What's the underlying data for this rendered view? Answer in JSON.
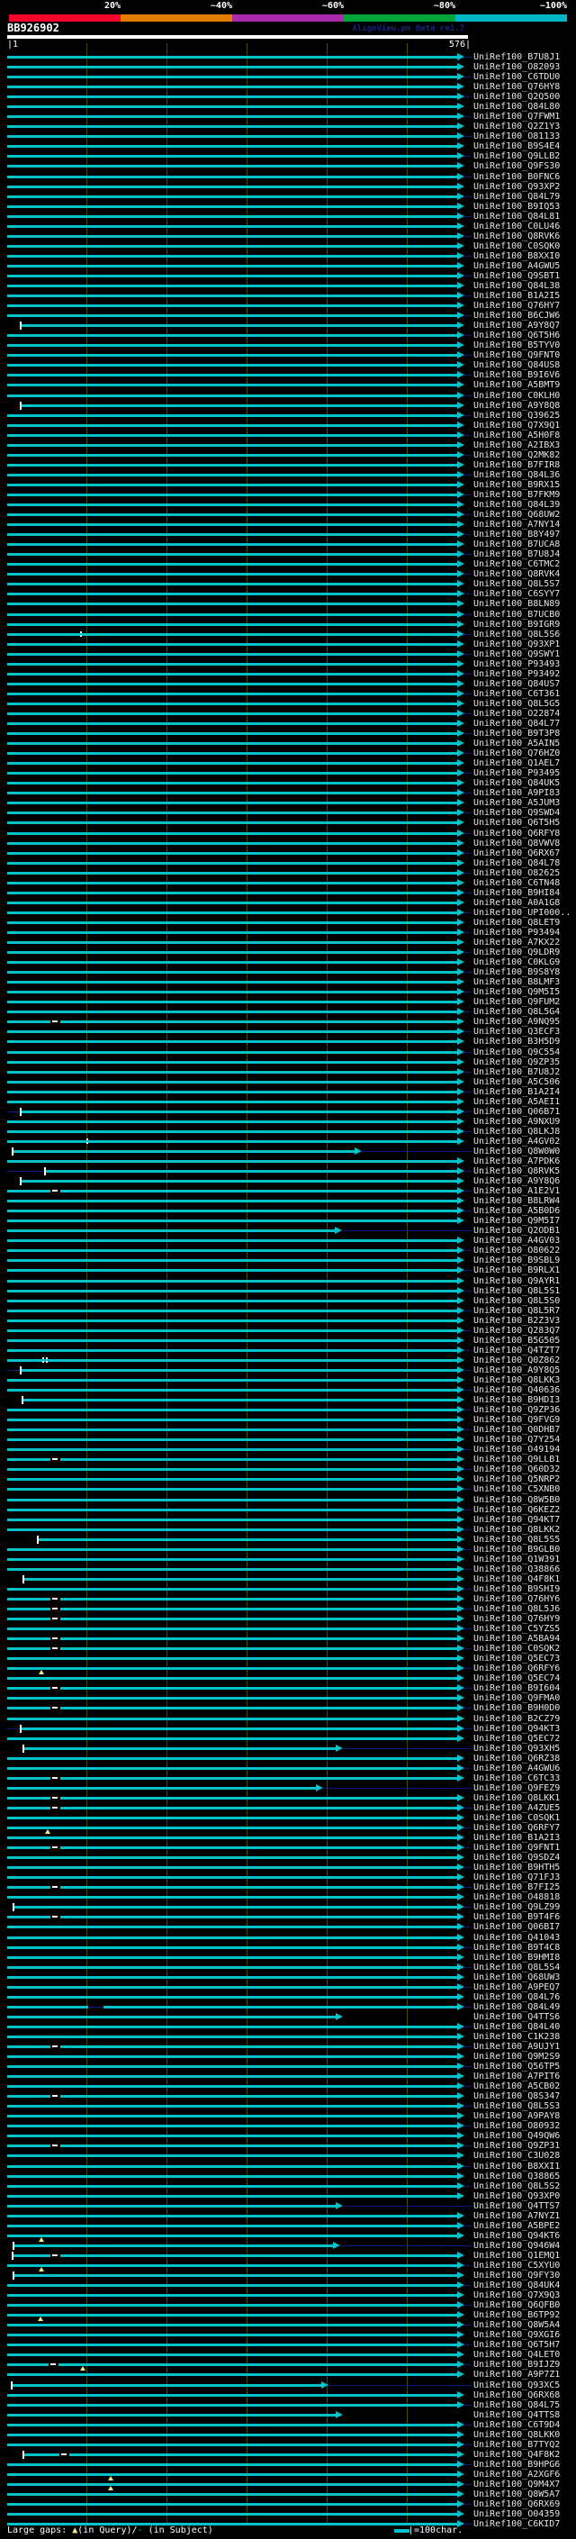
{
  "header": {
    "scale": {
      "segments": [
        {
          "label": "20%",
          "color": "#f2062c"
        },
        {
          "label": "~40%",
          "color": "#e57d00"
        },
        {
          "label": "~60%",
          "color": "#a92aaa"
        },
        {
          "label": "~80%",
          "color": "#00a63c"
        },
        {
          "label": "~100%",
          "color": "#00b7c3"
        }
      ]
    },
    "query_name": "BB926902",
    "watermark": "AlignView.pm Beta re1.7",
    "ruler": {
      "start_label": "|1",
      "end_label": "576|"
    }
  },
  "chart_data": {
    "type": "alignment-coverage-map",
    "title": "BB926902",
    "query_length": 576,
    "tick_interval_chars": 100,
    "label_prefix": "UniRef100_",
    "colors": {
      "bar": "#00c2cb",
      "tail": "#0a1a80",
      "grid": "#454500",
      "gap_query_triangle": "#f0f07c",
      "gap_subject_dash": "#ffffff",
      "label_text": "#e5e5e5"
    },
    "rows": [
      {
        "acc": "B7U8J1"
      },
      {
        "acc": "O82093"
      },
      {
        "acc": "C6TDU0"
      },
      {
        "acc": "Q76HY8"
      },
      {
        "acc": "Q2Q500"
      },
      {
        "acc": "Q84L80"
      },
      {
        "acc": "Q7FWM1"
      },
      {
        "acc": "Q2Z1Y3"
      },
      {
        "acc": "O81133"
      },
      {
        "acc": "B9S4E4"
      },
      {
        "acc": "Q9LLB2"
      },
      {
        "acc": "Q9FS30"
      },
      {
        "acc": "B0FNC6"
      },
      {
        "acc": "Q93XP2"
      },
      {
        "acc": "Q84L79"
      },
      {
        "acc": "B9IQ53"
      },
      {
        "acc": "Q84L81"
      },
      {
        "acc": "C0LU46"
      },
      {
        "acc": "Q8RVK6"
      },
      {
        "acc": "C0SQK0"
      },
      {
        "acc": "B8XXI0"
      },
      {
        "acc": "A4GWU5"
      },
      {
        "acc": "Q9SBT1"
      },
      {
        "acc": "Q84L38"
      },
      {
        "acc": "B1A2I5"
      },
      {
        "acc": "Q76HY7"
      },
      {
        "acc": "B6CJW6"
      },
      {
        "acc": "A9Y8Q7",
        "s": 18,
        "cap": true
      },
      {
        "acc": "Q6T5H6"
      },
      {
        "acc": "B5TYV0"
      },
      {
        "acc": "Q9FNT0"
      },
      {
        "acc": "Q84US8"
      },
      {
        "acc": "B9I6V6"
      },
      {
        "acc": "A5BMT9"
      },
      {
        "acc": "C0KLH0"
      },
      {
        "acc": "A9Y8Q8",
        "s": 18,
        "cap": true
      },
      {
        "acc": "Q39625"
      },
      {
        "acc": "Q7X9Q1"
      },
      {
        "acc": "A5H0F8"
      },
      {
        "acc": "A2IBX3"
      },
      {
        "acc": "Q2MK82"
      },
      {
        "acc": "B7FIR8"
      },
      {
        "acc": "Q84L36"
      },
      {
        "acc": "B9RX15"
      },
      {
        "acc": "B7FKM9"
      },
      {
        "acc": "Q84L39"
      },
      {
        "acc": "Q68UW2"
      },
      {
        "acc": "A7NY14"
      },
      {
        "acc": "B8Y497"
      },
      {
        "acc": "B7UCA8"
      },
      {
        "acc": "B7U8J4"
      },
      {
        "acc": "C6TMC2"
      },
      {
        "acc": "Q8RVK4"
      },
      {
        "acc": "Q8L5S7"
      },
      {
        "acc": "C6SYY7"
      },
      {
        "acc": "B8LN89"
      },
      {
        "acc": "B7UCB0"
      },
      {
        "acc": "B9IGR9"
      },
      {
        "acc": "Q8L5S6",
        "marks": [
          [
            "colon",
            92
          ]
        ]
      },
      {
        "acc": "Q93XP1"
      },
      {
        "acc": "Q9SWY1"
      },
      {
        "acc": "P93493"
      },
      {
        "acc": "P93492"
      },
      {
        "acc": "Q84US7"
      },
      {
        "acc": "C6T361"
      },
      {
        "acc": "Q8L5G5"
      },
      {
        "acc": "O22874"
      },
      {
        "acc": "Q84L77"
      },
      {
        "acc": "B9T3P8"
      },
      {
        "acc": "A5AIN5"
      },
      {
        "acc": "Q76HZ0"
      },
      {
        "acc": "Q1AEL7"
      },
      {
        "acc": "P93495"
      },
      {
        "acc": "Q84UK5"
      },
      {
        "acc": "A9PI83"
      },
      {
        "acc": "A5JUM3"
      },
      {
        "acc": "Q9SWD4"
      },
      {
        "acc": "Q6T5H5"
      },
      {
        "acc": "Q6RFY8"
      },
      {
        "acc": "Q8VWV8"
      },
      {
        "acc": "Q6RX67"
      },
      {
        "acc": "Q84L78"
      },
      {
        "acc": "O82625"
      },
      {
        "acc": "C6TN48"
      },
      {
        "acc": "B9HI84"
      },
      {
        "acc": "A0A1G8"
      },
      {
        "acc": "UPI000.."
      },
      {
        "acc": "Q8LET9"
      },
      {
        "acc": "P93494"
      },
      {
        "acc": "A7KX22"
      },
      {
        "acc": "Q9LDR9"
      },
      {
        "acc": "C0KLG9"
      },
      {
        "acc": "B9S8Y8"
      },
      {
        "acc": "B8LMF3"
      },
      {
        "acc": "Q9M5I5"
      },
      {
        "acc": "Q9FUM2"
      },
      {
        "acc": "Q8L5G4"
      },
      {
        "acc": "A9NQ95",
        "marks": [
          [
            "dash",
            61
          ]
        ]
      },
      {
        "acc": "Q3ECF3"
      },
      {
        "acc": "B3H5D9"
      },
      {
        "acc": "Q9C554"
      },
      {
        "acc": "Q9ZP35"
      },
      {
        "acc": "B7U8J2"
      },
      {
        "acc": "A5C506"
      },
      {
        "acc": "B1A2I4"
      },
      {
        "acc": "A5AEI1"
      },
      {
        "acc": "Q06B71",
        "s": 18,
        "cap": true,
        "lead": true
      },
      {
        "acc": "A9NXU9"
      },
      {
        "acc": "Q8LKJ8"
      },
      {
        "acc": "A4GV02",
        "marks": [
          [
            "colon",
            100
          ]
        ]
      },
      {
        "acc": "Q8W0W0",
        "s": 8,
        "cap": true,
        "e": 435
      },
      {
        "acc": "A7PDK6"
      },
      {
        "acc": "Q8RVK5",
        "s": 48,
        "cap": true,
        "lead": true
      },
      {
        "acc": "A9Y8Q6",
        "s": 18,
        "cap": true
      },
      {
        "acc": "A1E2V1",
        "marks": [
          [
            "dash",
            61
          ]
        ]
      },
      {
        "acc": "B8LRW4"
      },
      {
        "acc": "A5B0D6"
      },
      {
        "acc": "Q9M5I7"
      },
      {
        "acc": "Q2ODB1",
        "e": 410
      },
      {
        "acc": "A4GV03"
      },
      {
        "acc": "O80622"
      },
      {
        "acc": "B9SBL9"
      },
      {
        "acc": "B9RLX1"
      },
      {
        "acc": "Q9AYR1"
      },
      {
        "acc": "Q8L5S1"
      },
      {
        "acc": "Q8L5S0"
      },
      {
        "acc": "Q8L5R7"
      },
      {
        "acc": "B2Z3V3"
      },
      {
        "acc": "Q283Q7"
      },
      {
        "acc": "B5G505"
      },
      {
        "acc": "Q4TZT7"
      },
      {
        "acc": "Q0Z862",
        "marks": [
          [
            "colon2",
            45
          ]
        ]
      },
      {
        "acc": "A9Y8Q5",
        "s": 18,
        "cap": true,
        "lead": true
      },
      {
        "acc": "Q8LKK3"
      },
      {
        "acc": "Q40636"
      },
      {
        "acc": "B9HDI3",
        "s": 20,
        "cap": true
      },
      {
        "acc": "Q9ZP36"
      },
      {
        "acc": "Q9FVG9"
      },
      {
        "acc": "Q0DHB7"
      },
      {
        "acc": "Q7Y254"
      },
      {
        "acc": "O49194"
      },
      {
        "acc": "Q9LLB1",
        "marks": [
          [
            "dash",
            61
          ]
        ]
      },
      {
        "acc": "Q60D32"
      },
      {
        "acc": "Q5NRP2"
      },
      {
        "acc": "C5XNB0"
      },
      {
        "acc": "Q8W5B0"
      },
      {
        "acc": "Q6KEZ2"
      },
      {
        "acc": "Q94KT7"
      },
      {
        "acc": "Q8LKK2"
      },
      {
        "acc": "Q8L5S5",
        "s": 39,
        "cap": true
      },
      {
        "acc": "B9GLB0"
      },
      {
        "acc": "Q1W391"
      },
      {
        "acc": "Q38866"
      },
      {
        "acc": "Q4F8K1",
        "s": 21,
        "cap": true
      },
      {
        "acc": "B9SHI9"
      },
      {
        "acc": "Q76HY6",
        "marks": [
          [
            "dash",
            61
          ]
        ]
      },
      {
        "acc": "Q8L5J6",
        "marks": [
          [
            "dash",
            61
          ]
        ]
      },
      {
        "acc": "Q76HY9",
        "marks": [
          [
            "dash",
            61
          ]
        ]
      },
      {
        "acc": "C5YZS5"
      },
      {
        "acc": "A5BA94",
        "marks": [
          [
            "dash",
            61
          ]
        ]
      },
      {
        "acc": "C0SQK2",
        "marks": [
          [
            "dash",
            61
          ]
        ]
      },
      {
        "acc": "Q5EC73"
      },
      {
        "acc": "Q6RFY6",
        "marks": [
          [
            "tri",
            44
          ]
        ]
      },
      {
        "acc": "Q5EC74"
      },
      {
        "acc": "B9I604",
        "marks": [
          [
            "dash",
            61
          ]
        ]
      },
      {
        "acc": "Q9FMA0"
      },
      {
        "acc": "B9H0D0",
        "marks": [
          [
            "dash",
            61
          ]
        ]
      },
      {
        "acc": "B2CZ79"
      },
      {
        "acc": "Q94KT3",
        "s": 18,
        "cap": true,
        "lead": true
      },
      {
        "acc": "Q5EC72"
      },
      {
        "acc": "Q93XH5",
        "s": 21,
        "cap": true,
        "e": 411
      },
      {
        "acc": "Q6RZ38"
      },
      {
        "acc": "A4GWU6"
      },
      {
        "acc": "C6TC33",
        "marks": [
          [
            "dash",
            61
          ]
        ]
      },
      {
        "acc": "Q9FEZ9",
        "e": 386
      },
      {
        "acc": "Q8LKK1",
        "marks": [
          [
            "dash",
            61
          ]
        ]
      },
      {
        "acc": "A4ZUE5",
        "marks": [
          [
            "dash",
            61
          ]
        ]
      },
      {
        "acc": "C0SQK1"
      },
      {
        "acc": "Q6RFY7",
        "marks": [
          [
            "tri",
            51
          ]
        ]
      },
      {
        "acc": "B1A2I3"
      },
      {
        "acc": "Q9FNT1",
        "marks": [
          [
            "dash",
            61
          ]
        ]
      },
      {
        "acc": "Q9SDZ4"
      },
      {
        "acc": "B9HTH5"
      },
      {
        "acc": "Q71FJ3"
      },
      {
        "acc": "B7FI25",
        "marks": [
          [
            "dash",
            61
          ]
        ]
      },
      {
        "acc": "O48818"
      },
      {
        "acc": "Q9LZ99",
        "s": 9,
        "cap": true
      },
      {
        "acc": "B9T4F6",
        "marks": [
          [
            "dash",
            61
          ]
        ]
      },
      {
        "acc": "Q06BI7"
      },
      {
        "acc": "Q41043"
      },
      {
        "acc": "B9T4C8"
      },
      {
        "acc": "B9HMI8"
      },
      {
        "acc": "Q8L5S4"
      },
      {
        "acc": "Q68UW3"
      },
      {
        "acc": "A9PEQ7"
      },
      {
        "acc": "Q84L76"
      },
      {
        "acc": "Q84L49",
        "marks": [
          [
            "gap",
            102,
            121
          ]
        ]
      },
      {
        "acc": "Q4TTS6",
        "e": 411
      },
      {
        "acc": "Q84L40"
      },
      {
        "acc": "C1K238"
      },
      {
        "acc": "A9UJY1",
        "marks": [
          [
            "dash",
            61
          ]
        ]
      },
      {
        "acc": "Q9M2S9"
      },
      {
        "acc": "Q56TP5"
      },
      {
        "acc": "A7PIT6"
      },
      {
        "acc": "A5CB02"
      },
      {
        "acc": "Q8S347",
        "marks": [
          [
            "dash",
            61
          ]
        ]
      },
      {
        "acc": "Q8L5S3"
      },
      {
        "acc": "A9PAY8"
      },
      {
        "acc": "O80932"
      },
      {
        "acc": "Q49QW6"
      },
      {
        "acc": "Q9ZP31",
        "marks": [
          [
            "dash",
            61
          ]
        ]
      },
      {
        "acc": "C3U028"
      },
      {
        "acc": "B8XXI1"
      },
      {
        "acc": "Q38865"
      },
      {
        "acc": "Q8L5S2"
      },
      {
        "acc": "Q93XP0"
      },
      {
        "acc": "Q4TTS7",
        "e": 411
      },
      {
        "acc": "A7NYZ1"
      },
      {
        "acc": "A5BPE2"
      },
      {
        "acc": "Q94KT6",
        "marks": [
          [
            "tri",
            44
          ]
        ]
      },
      {
        "acc": "Q946W4",
        "s": 9,
        "cap": true,
        "e": 408
      },
      {
        "acc": "Q1EMQ1",
        "s": 8,
        "cap": true,
        "marks": [
          [
            "dash",
            61
          ]
        ]
      },
      {
        "acc": "C5XYU0",
        "marks": [
          [
            "tri",
            44
          ]
        ]
      },
      {
        "acc": "Q9FY30",
        "s": 9,
        "cap": true
      },
      {
        "acc": "Q84UK4"
      },
      {
        "acc": "Q7X9Q3"
      },
      {
        "acc": "Q6QFB0"
      },
      {
        "acc": "B6TP92",
        "marks": [
          [
            "tri",
            43
          ]
        ]
      },
      {
        "acc": "Q8W5A4"
      },
      {
        "acc": "Q9XGI6"
      },
      {
        "acc": "Q6T5H7"
      },
      {
        "acc": "Q4LET0"
      },
      {
        "acc": "B9IJZ9",
        "marks": [
          [
            "dash",
            58
          ],
          [
            "tri",
            95
          ]
        ]
      },
      {
        "acc": "A9P7Z1"
      },
      {
        "acc": "Q93XC5",
        "s": 7,
        "cap": true,
        "e": 393
      },
      {
        "acc": "Q6RX68"
      },
      {
        "acc": "Q84L75"
      },
      {
        "acc": "Q4TTS8",
        "e": 411
      },
      {
        "acc": "C6T9D4"
      },
      {
        "acc": "Q8LKK0"
      },
      {
        "acc": "B7TYQ2"
      },
      {
        "acc": "Q4F8K2",
        "s": 21,
        "cap": true,
        "marks": [
          [
            "dash",
            72
          ]
        ]
      },
      {
        "acc": "B9HPG6"
      },
      {
        "acc": "A2XGF6",
        "marks": [
          [
            "tri",
            130
          ]
        ]
      },
      {
        "acc": "Q9M4X7",
        "marks": [
          [
            "tri",
            130
          ]
        ]
      },
      {
        "acc": "Q8W5A7"
      },
      {
        "acc": "Q6RX69"
      },
      {
        "acc": "O04359"
      },
      {
        "acc": "C6KID7"
      }
    ]
  },
  "footer": {
    "legend_left": {
      "prefix": "Large gaps: ",
      "triangle": "▲",
      "mid": "(in Query)/",
      "dash": "-",
      "suffix": " (in Subject)"
    },
    "legend_right": {
      "text": "=100char."
    }
  }
}
